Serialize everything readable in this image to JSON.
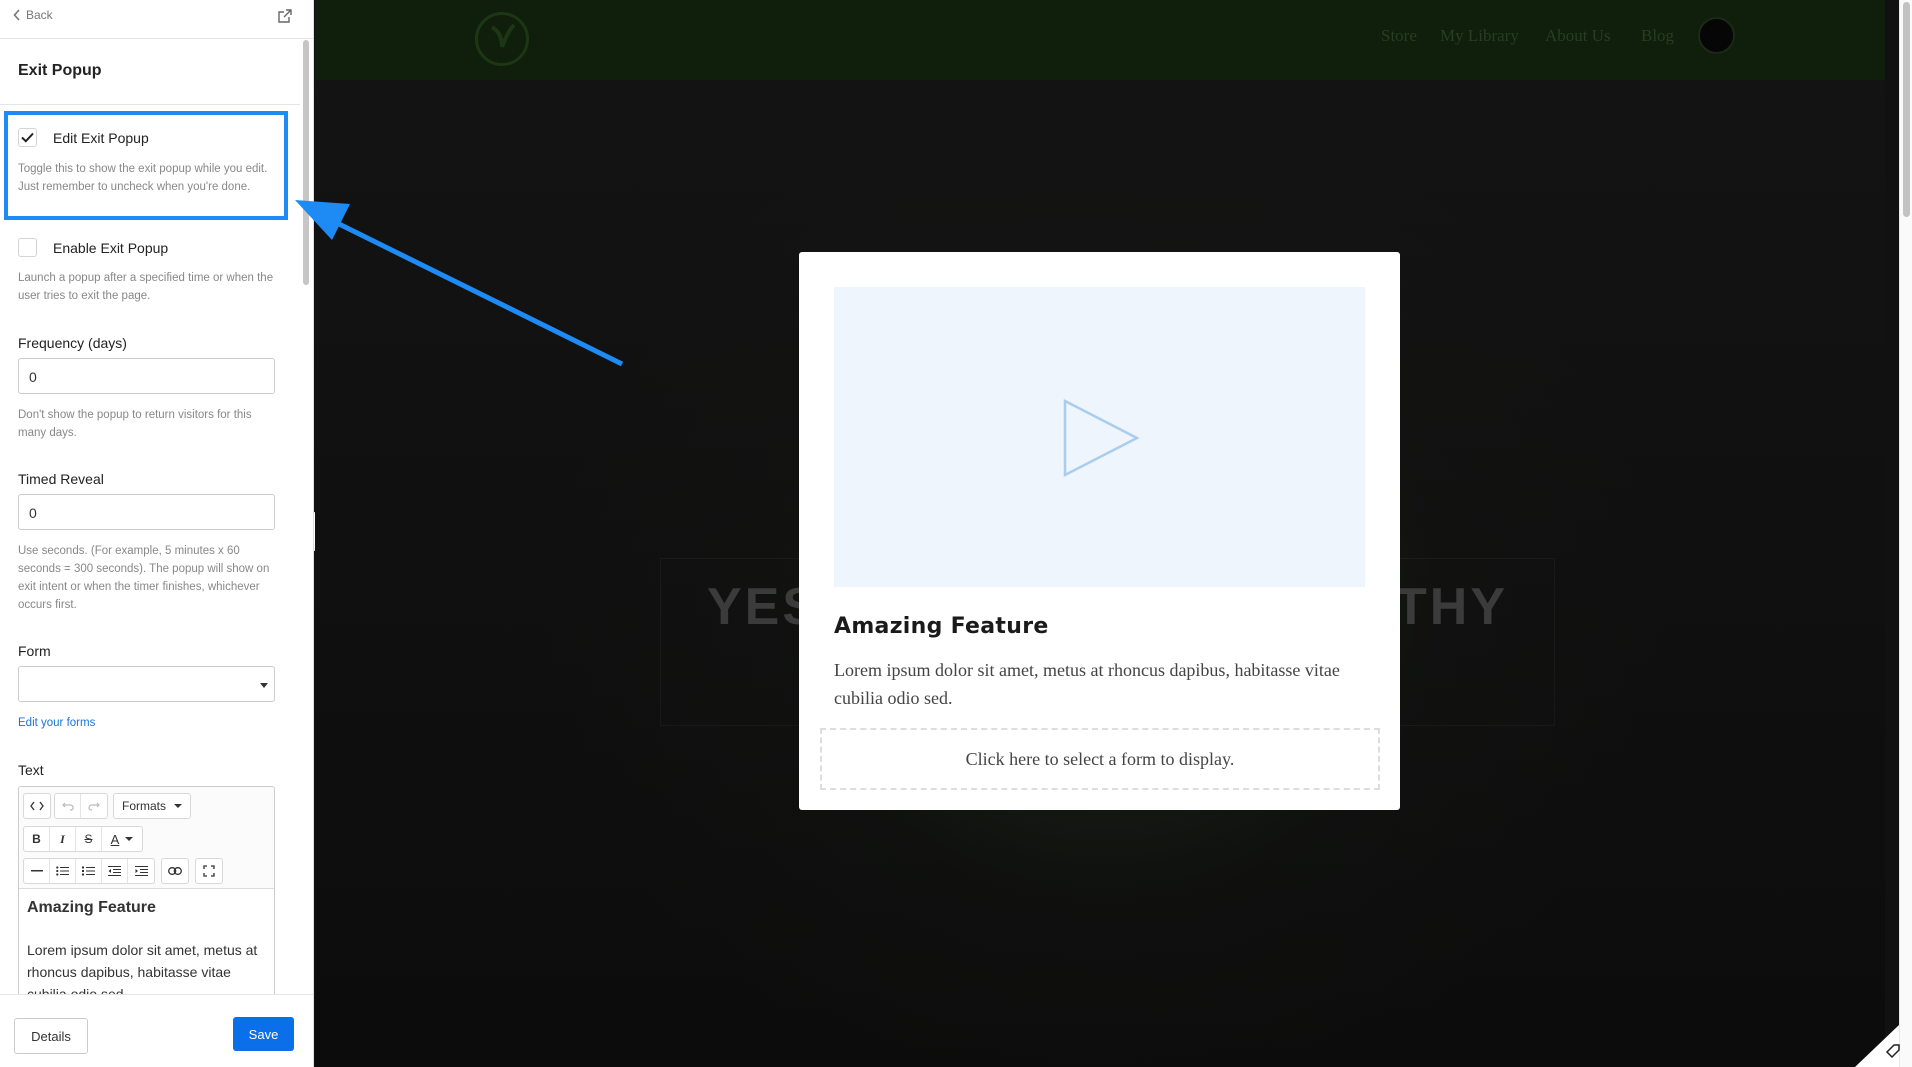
{
  "sidebar": {
    "back_label": "Back",
    "title": "Exit Popup",
    "edit_popup": {
      "label": "Edit Exit Popup",
      "checked": true,
      "help": "Toggle this to show the exit popup while you edit. Just remember to uncheck when you're done."
    },
    "enable_popup": {
      "label": "Enable Exit Popup",
      "checked": false,
      "help": "Launch a popup after a specified time or when the user tries to exit the page."
    },
    "frequency": {
      "label": "Frequency (days)",
      "value": "0",
      "help": "Don't show the popup to return visitors for this many days."
    },
    "timed_reveal": {
      "label": "Timed Reveal",
      "value": "0",
      "help": "Use seconds. (For example, 5 minutes x 60 seconds = 300 seconds). The popup will show on exit intent or when the timer finishes, whichever occurs first."
    },
    "form": {
      "label": "Form",
      "value": "",
      "edit_link": "Edit your forms"
    },
    "text": {
      "label": "Text",
      "formats_label": "Formats",
      "heading": "Amazing Feature",
      "body": "Lorem ipsum dolor sit amet, metus at rhoncus dapibus, habitasse vitae cubilia odio sed."
    },
    "footer": {
      "details_label": "Details",
      "save_label": "Save"
    }
  },
  "preview": {
    "nav": [
      "Store",
      "My Library",
      "About Us",
      "Blog"
    ],
    "hero_text": "YES I WANT TO BE HEALTHY",
    "popup": {
      "heading": "Amazing Feature",
      "body": "Lorem ipsum dolor sit amet, metus at rhoncus dapibus, habitasse vitae cubilia odio sed.",
      "form_prompt": "Click here to select a form to display."
    }
  },
  "colors": {
    "highlight": "#1e8bf5",
    "primary_button": "#0a6fe8",
    "link": "#1a73d9"
  }
}
